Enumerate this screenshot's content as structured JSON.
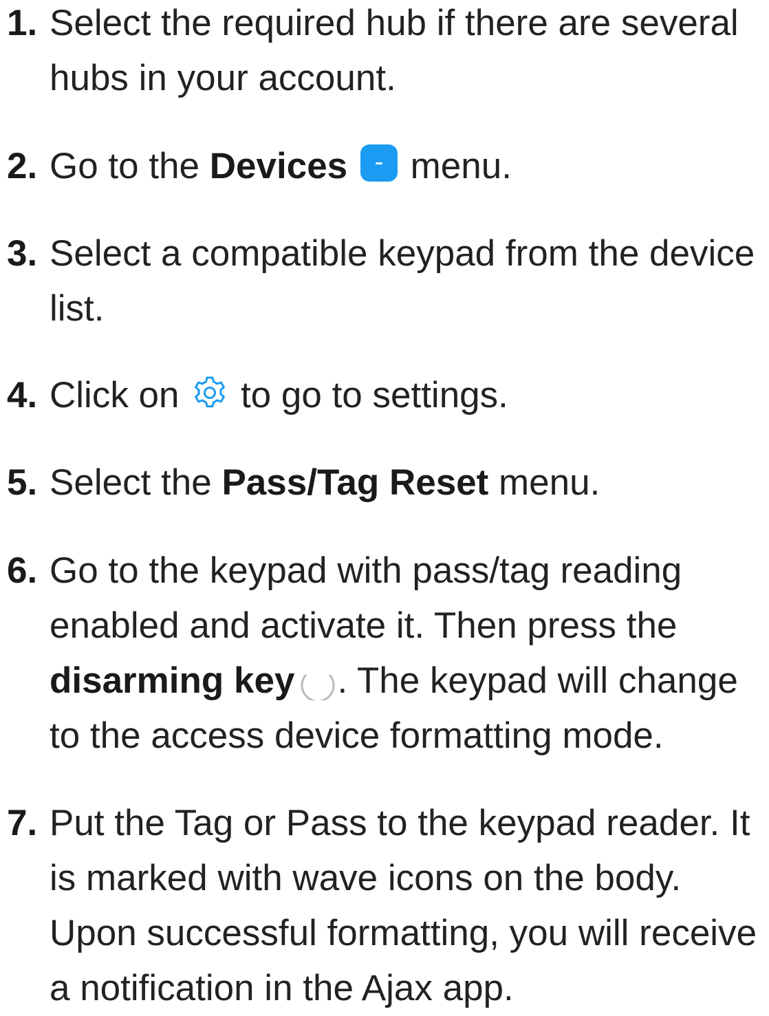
{
  "steps": [
    {
      "number": "1.",
      "text": "Select the required hub if there are several hubs in your account."
    },
    {
      "number": "2.",
      "before": "Go to the ",
      "bold": "Devices",
      "icon": "devices-icon",
      "after": " menu."
    },
    {
      "number": "3.",
      "text": "Select a compatible keypad from the device list."
    },
    {
      "number": "4.",
      "before": "Click on ",
      "icon": "gear-icon",
      "after": " to go to settings."
    },
    {
      "number": "5.",
      "before": "Select the ",
      "bold": "Pass/Tag Reset",
      "after": " menu."
    },
    {
      "number": "6.",
      "before": "Go to the keypad with pass/tag reading enabled and activate it. Then press the ",
      "bold": "disarming key",
      "icon": "disarm-key-icon",
      "after": ". The keypad will change to the access device formatting mode."
    },
    {
      "number": "7.",
      "text": "Put the Tag or Pass to the keypad reader. It is marked with wave icons on the body. Upon successful formatting, you will receive a notification in the Ajax app."
    }
  ],
  "colors": {
    "text": "#222222",
    "accent": "#1b9cf2",
    "key_icon": "#b8b8b8"
  }
}
